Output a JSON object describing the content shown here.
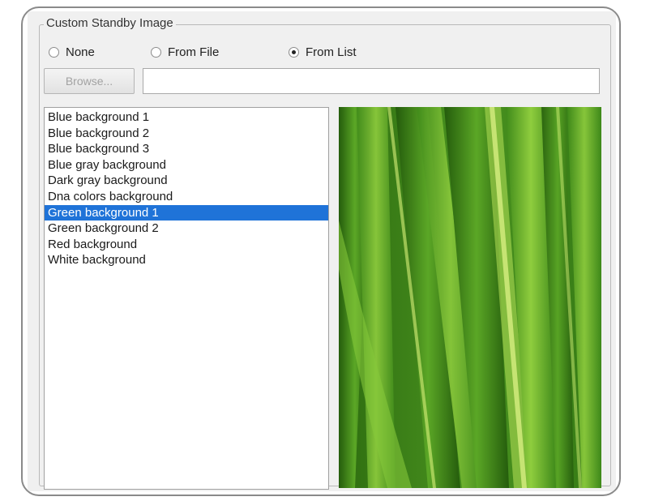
{
  "group": {
    "title": "Custom Standby Image"
  },
  "radios": {
    "none": {
      "label": "None",
      "checked": false
    },
    "from_file": {
      "label": "From File",
      "checked": false
    },
    "from_list": {
      "label": "From List",
      "checked": true
    }
  },
  "browse": {
    "button_label": "Browse...",
    "path_value": ""
  },
  "list": {
    "items": [
      {
        "label": "Blue background 1",
        "selected": false
      },
      {
        "label": "Blue background 2",
        "selected": false
      },
      {
        "label": "Blue background 3",
        "selected": false
      },
      {
        "label": "Blue gray background",
        "selected": false
      },
      {
        "label": "Dark gray background",
        "selected": false
      },
      {
        "label": "Dna colors background",
        "selected": false
      },
      {
        "label": "Green background 1",
        "selected": true
      },
      {
        "label": "Green background 2",
        "selected": false
      },
      {
        "label": "Red background",
        "selected": false
      },
      {
        "label": "White background",
        "selected": false
      }
    ]
  },
  "preview": {
    "image": "green-grass-leaves-image",
    "colors": {
      "dark": "#2f6f12",
      "mid": "#4d9a1e",
      "light": "#9fd64a",
      "highlight": "#d6f07a"
    }
  },
  "colors": {
    "selection": "#1f73d8",
    "window": "#f0f0f0"
  }
}
